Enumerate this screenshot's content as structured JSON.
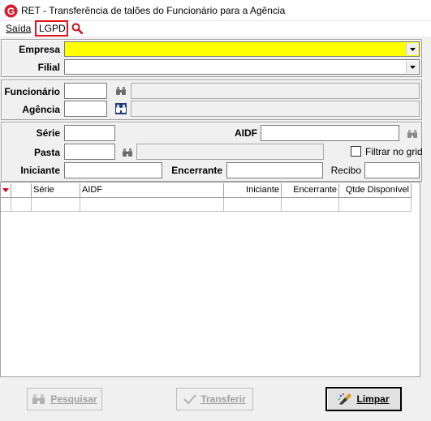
{
  "window": {
    "title": "RET - Transferência de talões do Funcionário para a Agência",
    "logo_letter": "G",
    "accent": "#d81e2c"
  },
  "menu": {
    "items": [
      "Saída",
      "LGPD"
    ],
    "search_icon": "magnifier-icon",
    "highlight_color": "#e3141b"
  },
  "top_group": {
    "empresa_label": "Empresa",
    "empresa_value": "",
    "empresa_bg": "#ffff00",
    "filial_label": "Filial",
    "filial_value": ""
  },
  "func_group": {
    "funcionario_label": "Funcionário",
    "funcionario_code": "",
    "funcionario_name": "",
    "agencia_label": "Agência",
    "agencia_code": "",
    "agencia_name": ""
  },
  "filter_group": {
    "serie_label": "Série",
    "serie_value": "",
    "aidf_label": "AIDF",
    "aidf_value": "",
    "pasta_label": "Pasta",
    "pasta_code": "",
    "pasta_name": "",
    "filtrar_label": "Filtrar no grid",
    "filtrar_checked": false,
    "iniciante_label": "Iniciante",
    "iniciante_value": "",
    "encerrante_label": "Encerrante",
    "encerrante_value": "",
    "recibo_label": "Recibo",
    "recibo_value": ""
  },
  "grid": {
    "columns": [
      "",
      "",
      "Série",
      "AIDF",
      "Iniciante",
      "Encerrante",
      "Qtde Disponível"
    ],
    "rows": [
      [
        "",
        "",
        "",
        "",
        "",
        "",
        ""
      ]
    ]
  },
  "buttons": {
    "pesquisar": "Pesquisar",
    "transferir": "Transferir",
    "limpar": "Limpar"
  }
}
